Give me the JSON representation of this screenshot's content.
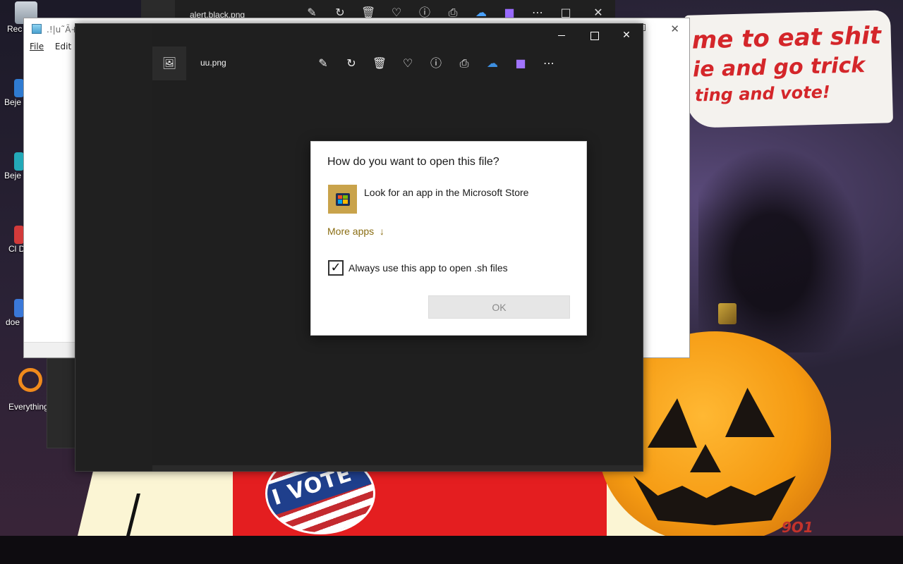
{
  "wallpaper": {
    "banner_line1": "me to eat shit",
    "banner_line2": "ie and go trick",
    "banner_line3": "ting and vote!",
    "badge_text": "I VOTE",
    "pumpkin_label": "9O1"
  },
  "desktop_icons": [
    {
      "label": "Rec",
      "icon": "recycle-bin-icon"
    },
    {
      "label": "Beje D",
      "icon": "game-shortcut-icon"
    },
    {
      "label": "Beje D",
      "icon": "game-shortcut-icon"
    },
    {
      "label": "Cl D",
      "icon": "game-shortcut-icon"
    },
    {
      "label": "doe",
      "icon": "app-shortcut-icon"
    },
    {
      "label": "Everything",
      "icon": "search-app-icon"
    }
  ],
  "background_photos": {
    "title": "alert.black.png"
  },
  "notepad": {
    "title": ".!|u˜Ã+¼",
    "menu": [
      "File",
      "Edit"
    ]
  },
  "photos_window": {
    "file_name": "uu.png",
    "tools": [
      "edit-icon",
      "rotate-icon",
      "delete-icon",
      "favorite-icon",
      "info-icon",
      "print-icon",
      "onedrive-icon",
      "clipchamp-icon",
      "more-icon"
    ]
  },
  "dialog": {
    "title": "How do you want to open this file?",
    "store_option": "Look for an app in the Microsoft Store",
    "more_apps": "More apps",
    "always_use_label": "Always use this app to open .sh files",
    "always_use_checked": true,
    "ok_label": "OK"
  },
  "colors": {
    "accent_link": "#8a6d12",
    "store_tile": "#c9a34b",
    "photos_bg": "#1f1f1f"
  }
}
